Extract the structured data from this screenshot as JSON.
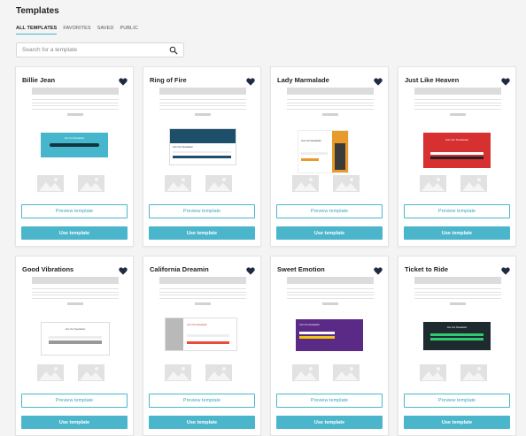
{
  "header": {
    "title": "Templates"
  },
  "tabs": [
    {
      "label": "ALL TEMPLATES",
      "active": true
    },
    {
      "label": "FAVORITES",
      "active": false
    },
    {
      "label": "SAVED",
      "active": false
    },
    {
      "label": "PUBLIC",
      "active": false
    }
  ],
  "search": {
    "placeholder": "Search for a template",
    "icon": "search-icon"
  },
  "buttons": {
    "preview": "Preview template",
    "use": "Use template"
  },
  "templates": [
    {
      "title": "Billie Jean",
      "favorite_icon": "heart-icon",
      "newsletter_text": "Join Our Newsletter"
    },
    {
      "title": "Ring of Fire",
      "favorite_icon": "heart-icon",
      "newsletter_text": "Join Our Newsletter"
    },
    {
      "title": "Lady Marmalade",
      "favorite_icon": "heart-icon",
      "newsletter_text": "Join Our Newsletter"
    },
    {
      "title": "Just Like Heaven",
      "favorite_icon": "heart-icon",
      "newsletter_text": "Join Our Newsletter"
    },
    {
      "title": "Good Vibrations",
      "favorite_icon": "heart-icon",
      "newsletter_text": "Join Our Newsletter"
    },
    {
      "title": "California Dreamin",
      "favorite_icon": "heart-icon",
      "newsletter_text": "Join Our Newsletter"
    },
    {
      "title": "Sweet Emotion",
      "favorite_icon": "heart-icon",
      "newsletter_text": "Join Our Newsletter"
    },
    {
      "title": "Ticket to Ride",
      "favorite_icon": "heart-icon",
      "newsletter_text": "Join Our Newsletter"
    }
  ],
  "colors": {
    "accent": "#4bb6cb",
    "heart": "#1f2a44"
  }
}
